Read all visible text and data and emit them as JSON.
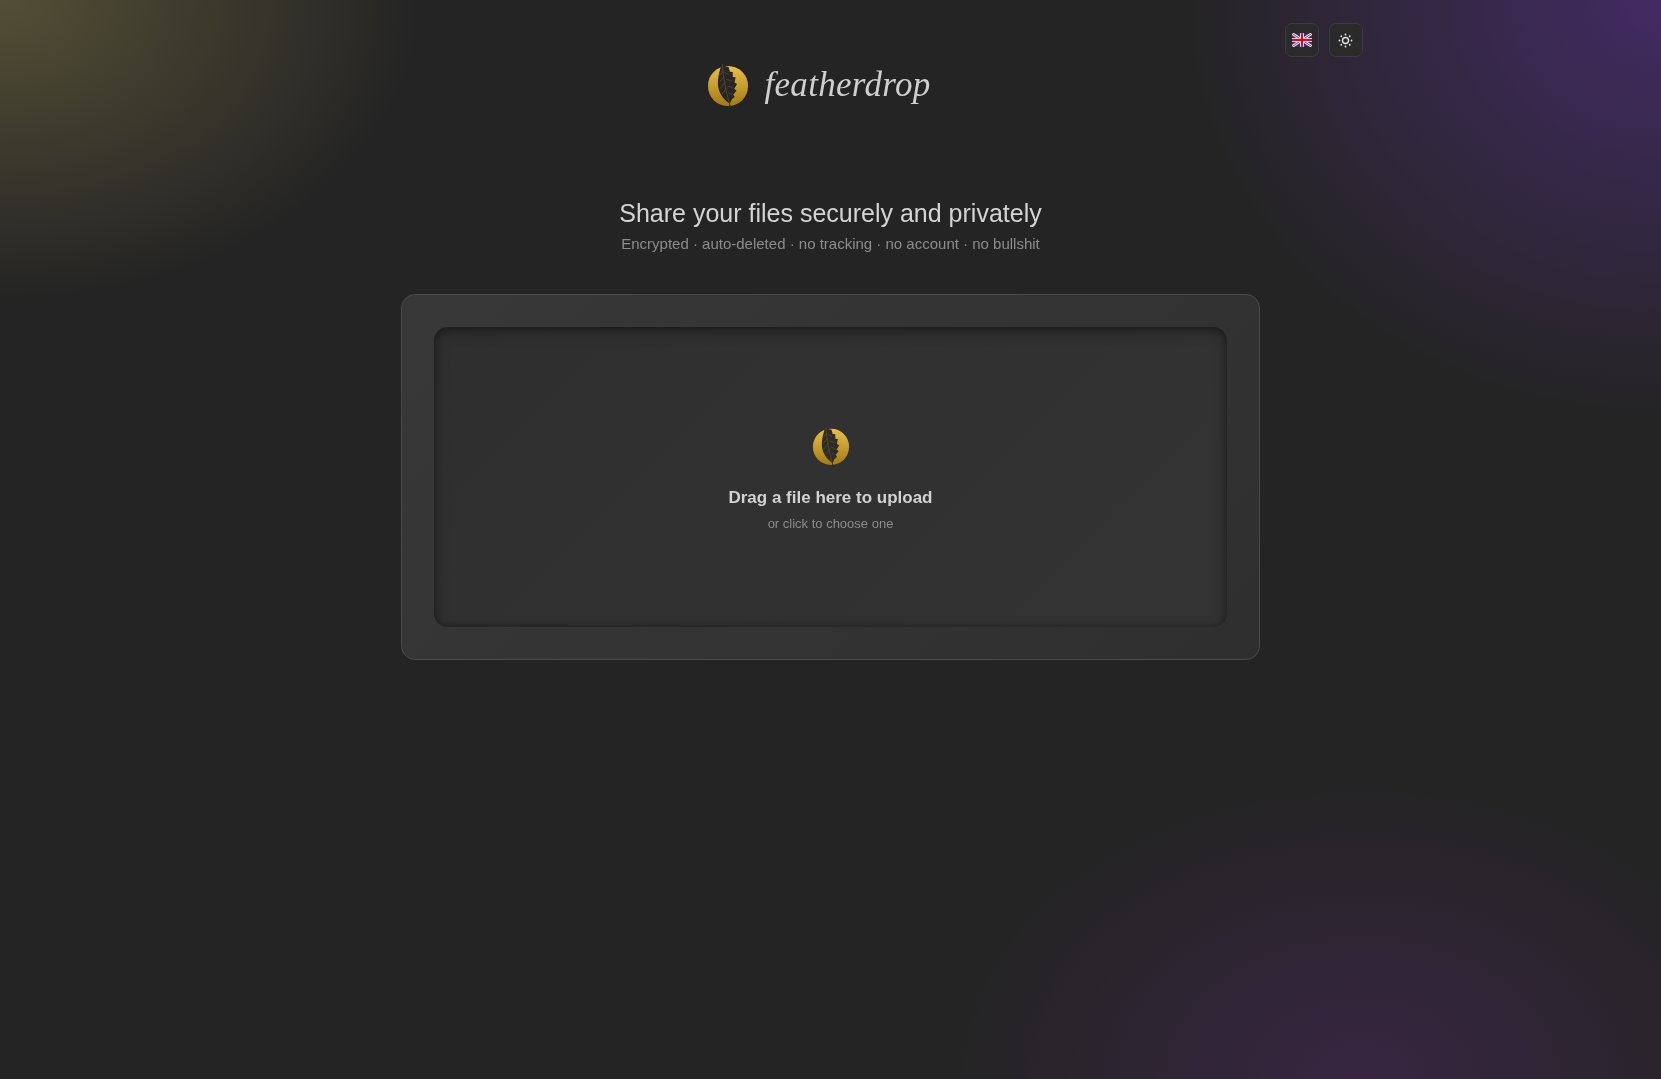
{
  "brand": {
    "name": "featherdrop"
  },
  "hero": {
    "title": "Share your files securely and privately",
    "tagline": "Encrypted · auto-deleted · no tracking · no account · no bullshit"
  },
  "dropzone": {
    "title": "Drag a file here to upload",
    "hint": "or click to choose one"
  }
}
